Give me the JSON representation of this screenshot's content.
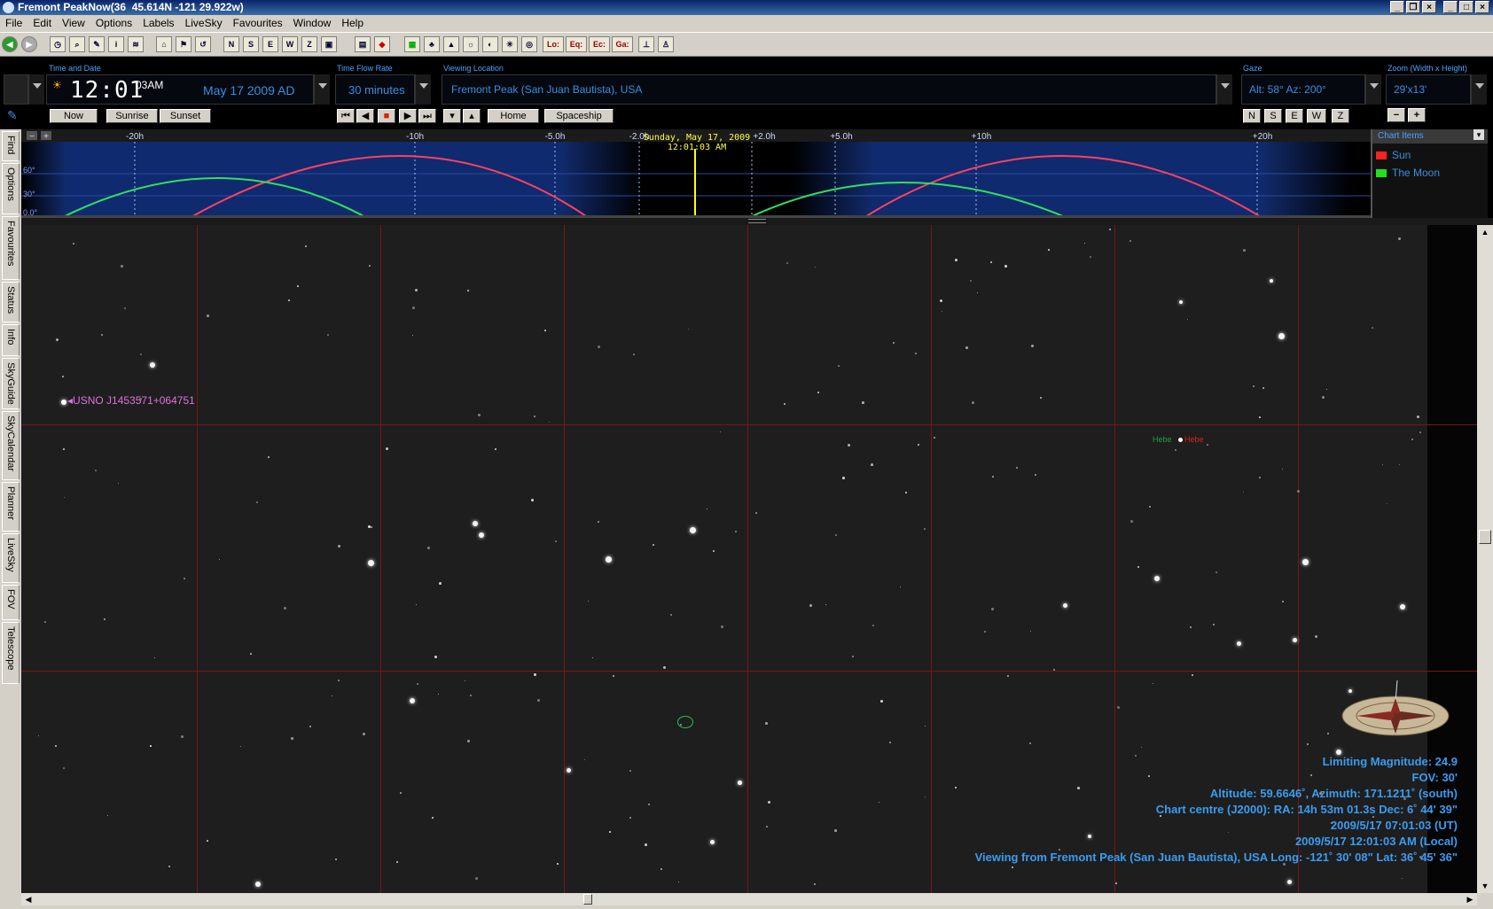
{
  "window": {
    "title": "Fremont PeakNow(36  45.614N -121 29.922w)"
  },
  "menu": [
    "File",
    "Edit",
    "View",
    "Options",
    "Labels",
    "LiveSky",
    "Favourites",
    "Window",
    "Help"
  ],
  "toolbar": {
    "labels": [
      "Lo:",
      "Eq:",
      "Ec:",
      "Ga:"
    ]
  },
  "time": {
    "label": "Time and Date",
    "clock": "12:01",
    "seconds": "03AM",
    "date": "May 17   2009 AD",
    "now": "Now",
    "sunrise": "Sunrise",
    "sunset": "Sunset"
  },
  "flow": {
    "label": "Time Flow Rate",
    "value": "30 minutes"
  },
  "location": {
    "label": "Viewing Location",
    "value": "Fremont Peak (San Juan Bautista), USA",
    "home": "Home",
    "spaceship": "Spaceship"
  },
  "gaze": {
    "label": "Gaze",
    "value": "Alt: 58° Az: 200°",
    "dirs": [
      "N",
      "S",
      "E",
      "W",
      "Z"
    ]
  },
  "zoom": {
    "label": "Zoom (Width x Height)",
    "value": "29'x13'"
  },
  "sidetabs": [
    "Find",
    "Options",
    "Favourites",
    "Status",
    "Info",
    "SkyGuide",
    "SkyCalendar",
    "Planner",
    "LiveSky",
    "FOV",
    "Telescope"
  ],
  "timeline": {
    "ticks": [
      "-20h",
      "-10h",
      "-5.0h",
      "-2.0h",
      "+2.0h",
      "+5.0h",
      "+10h",
      "+20h"
    ],
    "current_date": "Sunday, May 17, 2009",
    "current_time": "12:01:03 AM",
    "alt_labels": [
      "60°",
      "30°",
      "0.0°"
    ],
    "legend_title": "Chart Items",
    "legend": [
      {
        "name": "Sun",
        "color": "#ff2020"
      },
      {
        "name": "The Moon",
        "color": "#20e020"
      }
    ]
  },
  "sky": {
    "star_label": "USNO J1453571+064751",
    "hebe_label_green": "Hebe",
    "hebe_label_red": "Hebe",
    "info": {
      "limiting": "Limiting Magnitude: 24.9",
      "fov": "FOV: 30'",
      "altaz": "Altitude: 59.6646˚, Azimuth: 171.1211˚ (south)",
      "centre": "Chart centre (J2000): RA: 14h 53m 01.3s Dec: 6˚ 44' 39\"",
      "ut": "2009/5/17 07:01:03 (UT)",
      "local": "2009/5/17 12:01:03 AM (Local)",
      "viewing": "Viewing from Fremont Peak (San Juan Bautista), USA     Long: -121˚ 30' 08\" Lat: 36˚ 45' 36\""
    }
  },
  "colors": {
    "accent": "#3a9cf0",
    "grid": "#8b1a1a",
    "sun_curve": "#ff4060",
    "moon_curve": "#30e060",
    "night_sky": "#0c1a4a"
  }
}
